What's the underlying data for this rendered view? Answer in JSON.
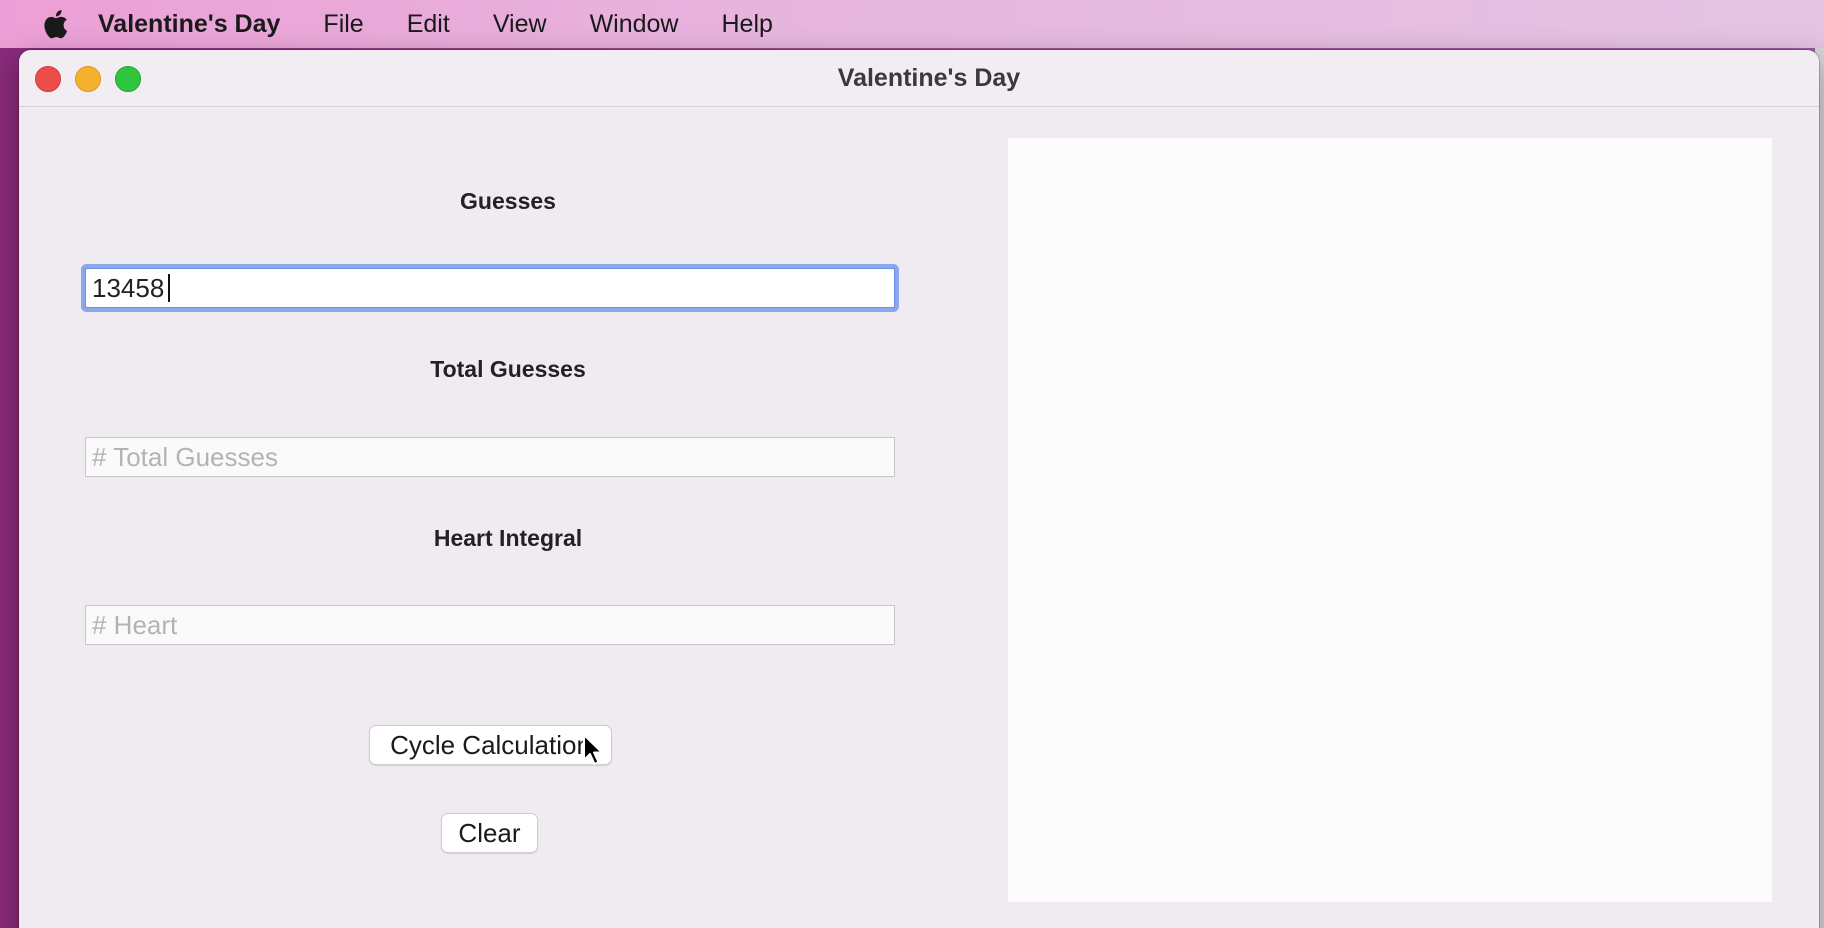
{
  "menubar": {
    "app_name": "Valentine's Day",
    "items": [
      "File",
      "Edit",
      "View",
      "Window",
      "Help"
    ],
    "apple_icon": "apple-logo-icon"
  },
  "window": {
    "title": "Valentine's Day",
    "controls": [
      "close",
      "minimize",
      "zoom"
    ]
  },
  "form": {
    "guesses": {
      "label": "Guesses",
      "value": "13458",
      "placeholder": ""
    },
    "total_guesses": {
      "label": "Total Guesses",
      "value": "",
      "placeholder": "# Total Guesses"
    },
    "heart_integral": {
      "label": "Heart Integral",
      "value": "",
      "placeholder": "# Heart"
    }
  },
  "buttons": {
    "cycle_label": "Cycle Calculation",
    "clear_label": "Clear"
  },
  "colors": {
    "focus_ring": "#8aa8ec",
    "window_bg": "#efebf0",
    "canvas_bg": "#fdfcfd"
  }
}
